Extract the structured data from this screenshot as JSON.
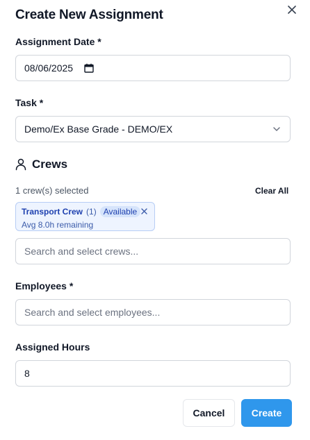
{
  "dialog": {
    "title": "Create New Assignment",
    "close_icon": "close-icon"
  },
  "date": {
    "label": "Assignment Date *",
    "value": "08/06/2025",
    "icon": "calendar-icon"
  },
  "task": {
    "label": "Task *",
    "value": "Demo/Ex Base Grade - DEMO/EX",
    "icon": "chevron-down-icon"
  },
  "crews": {
    "heading": "Crews",
    "icon": "user-icon",
    "selected_text": "1 crew(s) selected",
    "clear_all": "Clear All",
    "selected": [
      {
        "name": "Transport Crew",
        "count": "(1)",
        "status": "Available",
        "remaining": "Avg 8.0h remaining",
        "remove_icon": "remove-icon"
      }
    ],
    "search_placeholder": "Search and select crews..."
  },
  "employees": {
    "label": "Employees *",
    "search_placeholder": "Search and select employees..."
  },
  "hours": {
    "label": "Assigned Hours",
    "value": "8"
  },
  "actions": {
    "cancel": "Cancel",
    "create": "Create"
  },
  "colors": {
    "primary": "#2f97ec",
    "chip_bg": "#eef4ff",
    "chip_border": "#b7cdf5",
    "chip_text": "#1e40af"
  }
}
